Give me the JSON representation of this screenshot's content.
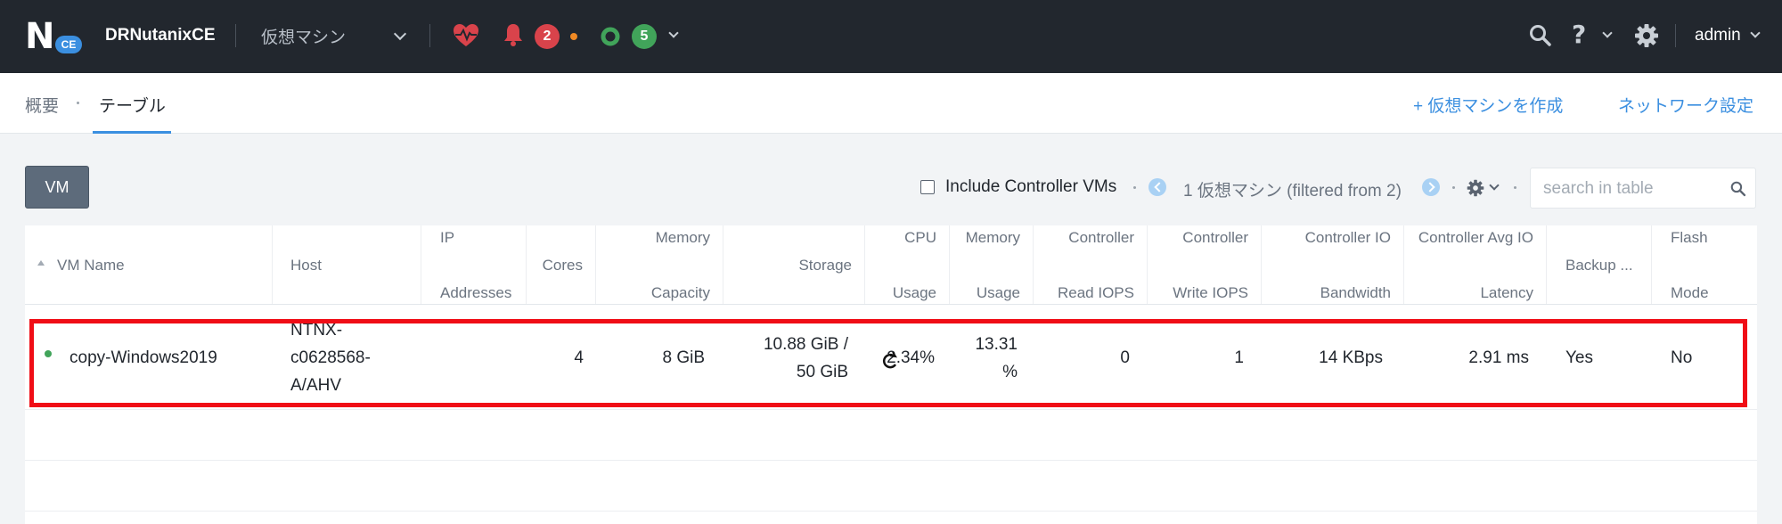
{
  "topbar": {
    "logo_letter": "N",
    "logo_badge": "CE",
    "cluster_name": "DRNutanixCE",
    "entity_selector": "仮想マシン",
    "alerts_count": "2",
    "tasks_count": "5",
    "user": "admin",
    "icons": [
      "heart-pulse-icon",
      "bell-icon",
      "circle-status-icon",
      "search-icon",
      "help-icon",
      "gear-icon"
    ],
    "colors": {
      "bar": "#22272e",
      "alert": "#d9434b",
      "task": "#41a45a",
      "warning_dot": "#f08a24"
    }
  },
  "subnav": {
    "tabs": [
      "概要",
      "テーブル"
    ],
    "active_tab": "テーブル",
    "create_vm": "+ 仮想マシンを作成",
    "network_settings": "ネットワーク設定"
  },
  "toolbar": {
    "vm_button": "VM",
    "include_controller_vms": "Include Controller VMs",
    "count_text": "1 仮想マシン (filtered from 2)",
    "search_placeholder": "search in table"
  },
  "table": {
    "columns": [
      "VM Name",
      "Host",
      "IP Addresses",
      "Cores",
      "Memory Capacity",
      "Storage",
      "CPU Usage",
      "Memory Usage",
      "Controller Read IOPS",
      "Controller Write IOPS",
      "Controller IO Bandwidth",
      "Controller Avg IO Latency",
      "Backup ...",
      "Flash Mode"
    ],
    "header_lines": [
      [
        "VM Name"
      ],
      [
        "Host"
      ],
      [
        "IP",
        "Addresses"
      ],
      [
        "Cores"
      ],
      [
        "Memory",
        "Capacity"
      ],
      [
        "Storage"
      ],
      [
        "CPU",
        "Usage"
      ],
      [
        "Memory",
        "Usage"
      ],
      [
        "Controller",
        "Read IOPS"
      ],
      [
        "Controller",
        "Write IOPS"
      ],
      [
        "Controller IO",
        "Bandwidth"
      ],
      [
        "Controller Avg IO",
        "Latency"
      ],
      [
        "Backup ..."
      ],
      [
        "Flash",
        "Mode"
      ]
    ],
    "rows": [
      {
        "status": "on",
        "vm_name": "copy-Windows2019",
        "host_lines": [
          "NTNX-",
          "c0628568-",
          "A/AHV"
        ],
        "host": "NTNX-c0628568-A/AHV",
        "ip_addresses": "",
        "cores": "4",
        "memory_capacity": "8 GiB",
        "storage_lines": [
          "10.88 GiB /",
          "50 GiB"
        ],
        "storage": "10.88 GiB / 50 GiB",
        "cpu_usage": "2.34%",
        "memory_usage_lines": [
          "13.31",
          "%"
        ],
        "memory_usage": "13.31 %",
        "controller_read_iops": "0",
        "controller_write_iops": "1",
        "controller_io_bandwidth": "14 KBps",
        "controller_avg_io_latency": "2.91 ms",
        "backup": "Yes",
        "flash_mode": "No"
      }
    ]
  }
}
